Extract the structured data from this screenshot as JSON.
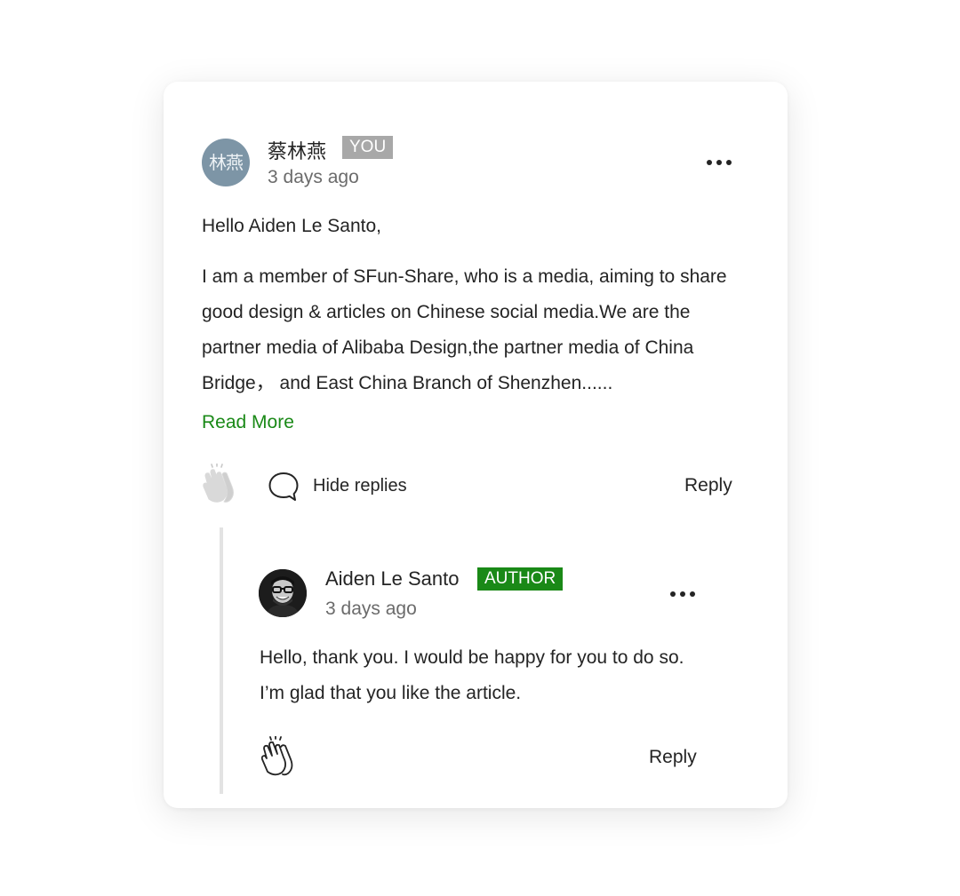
{
  "comment": {
    "avatar_text": "林燕",
    "author_name": "蔡林燕",
    "badge": "YOU",
    "time": "3 days ago",
    "greeting": "Hello Aiden Le Santo,",
    "body": "I am a member of SFun-Share, who is a media, aiming to share good design & articles on Chinese social media.We are the partner media of Alibaba Design,the partner media of China Bridge， and East China Branch of Shenzhen......",
    "read_more": "Read More",
    "hide_replies": "Hide replies",
    "reply_label": "Reply",
    "clap_icon": "clap-icon",
    "response_icon": "speech-bubble-icon"
  },
  "reply": {
    "author_name": "Aiden Le Santo",
    "badge": "AUTHOR",
    "time": "3 days ago",
    "body": "Hello, thank you. I would be happy for you to do so. I’m glad that you like the article.",
    "reply_label": "Reply",
    "clap_icon": "clap-icon"
  },
  "colors": {
    "accent_green": "#1a8917",
    "you_badge_gray": "#a8a8a8",
    "avatar_bg": "#7d95a6",
    "thread_line": "#e3e3e3"
  }
}
